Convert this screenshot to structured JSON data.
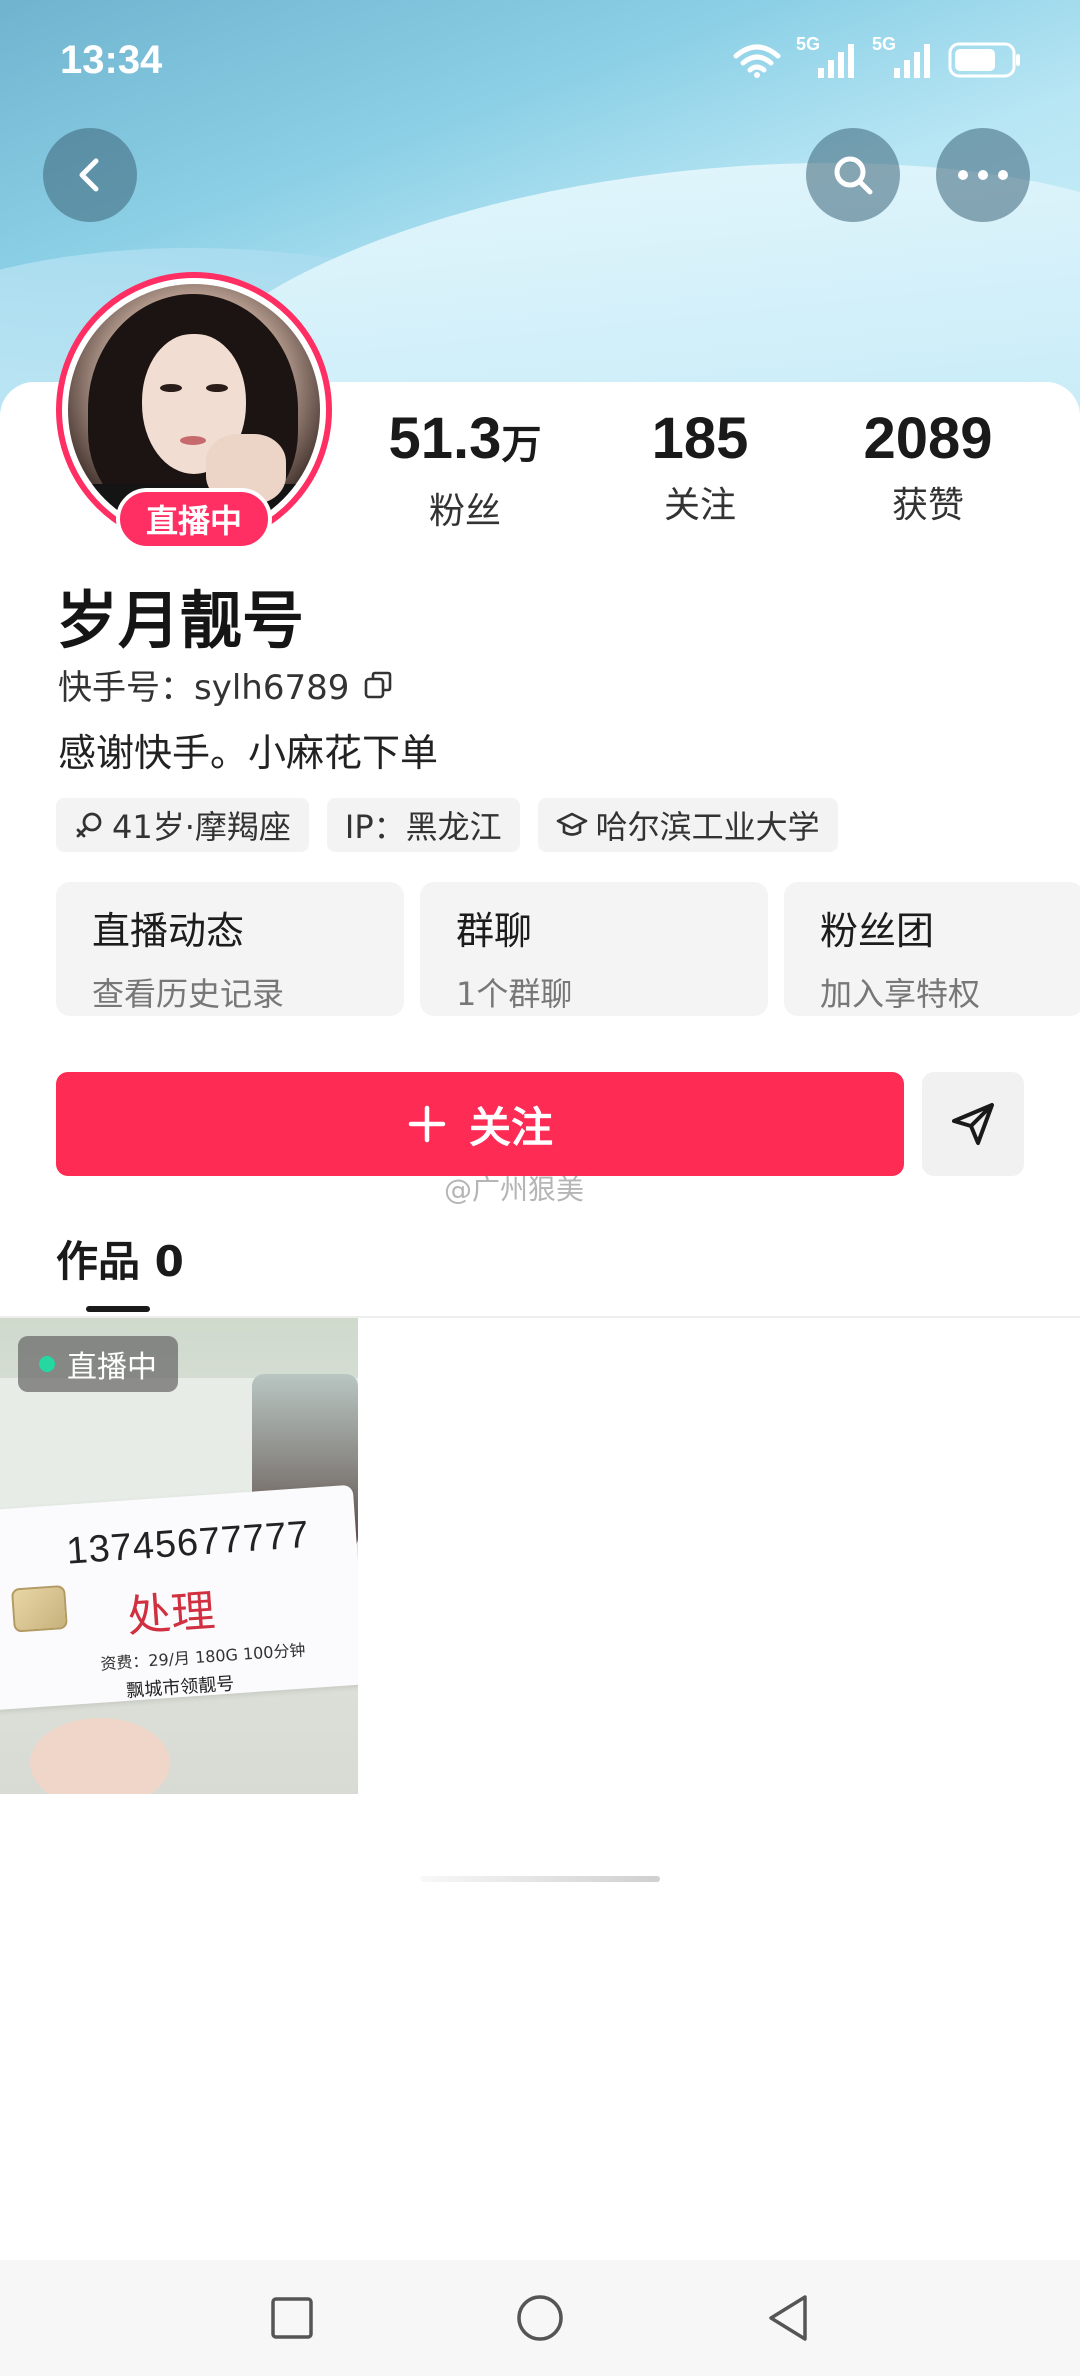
{
  "status_bar": {
    "time": "13:34",
    "net1": "5G",
    "net2": "5G"
  },
  "icons": {
    "back": "back-arrow-icon",
    "search": "search-icon",
    "more": "more-dots-icon",
    "copy": "copy-icon",
    "share": "send-icon"
  },
  "profile": {
    "live_badge": "直播中",
    "name": "岁月靓号",
    "id_label": "快手号：",
    "id_value": "sylh6789",
    "bio": "感谢快手。小麻花下单"
  },
  "stats": [
    {
      "num": "51.3",
      "unit": "万",
      "label": "粉丝"
    },
    {
      "num": "185",
      "unit": "",
      "label": "关注"
    },
    {
      "num": "2089",
      "unit": "",
      "label": "获赞"
    }
  ],
  "tags": [
    {
      "text": "41岁·摩羯座",
      "icon": "female-icon"
    },
    {
      "text": "IP：黑龙江",
      "icon": ""
    },
    {
      "text": "哈尔滨工业大学",
      "icon": "graduation-cap-icon"
    }
  ],
  "features": [
    {
      "title": "直播动态",
      "sub": "查看历史记录"
    },
    {
      "title": "群聊",
      "sub": "1个群聊"
    },
    {
      "title": "粉丝团",
      "sub": "加入享特权"
    }
  ],
  "actions": {
    "follow_label": "关注"
  },
  "watermark": "@广州狠美",
  "tabs": {
    "works_label": "作品",
    "works_count": "0"
  },
  "video": {
    "live_tag": "直播中",
    "phone_number": "13745677777",
    "stamp": "处理",
    "fee": "资费：29/月 180G 100分钟",
    "shop": "飘城市领靓号"
  },
  "colors": {
    "accent": "#fe2c55",
    "live_green": "#25d7a0"
  }
}
